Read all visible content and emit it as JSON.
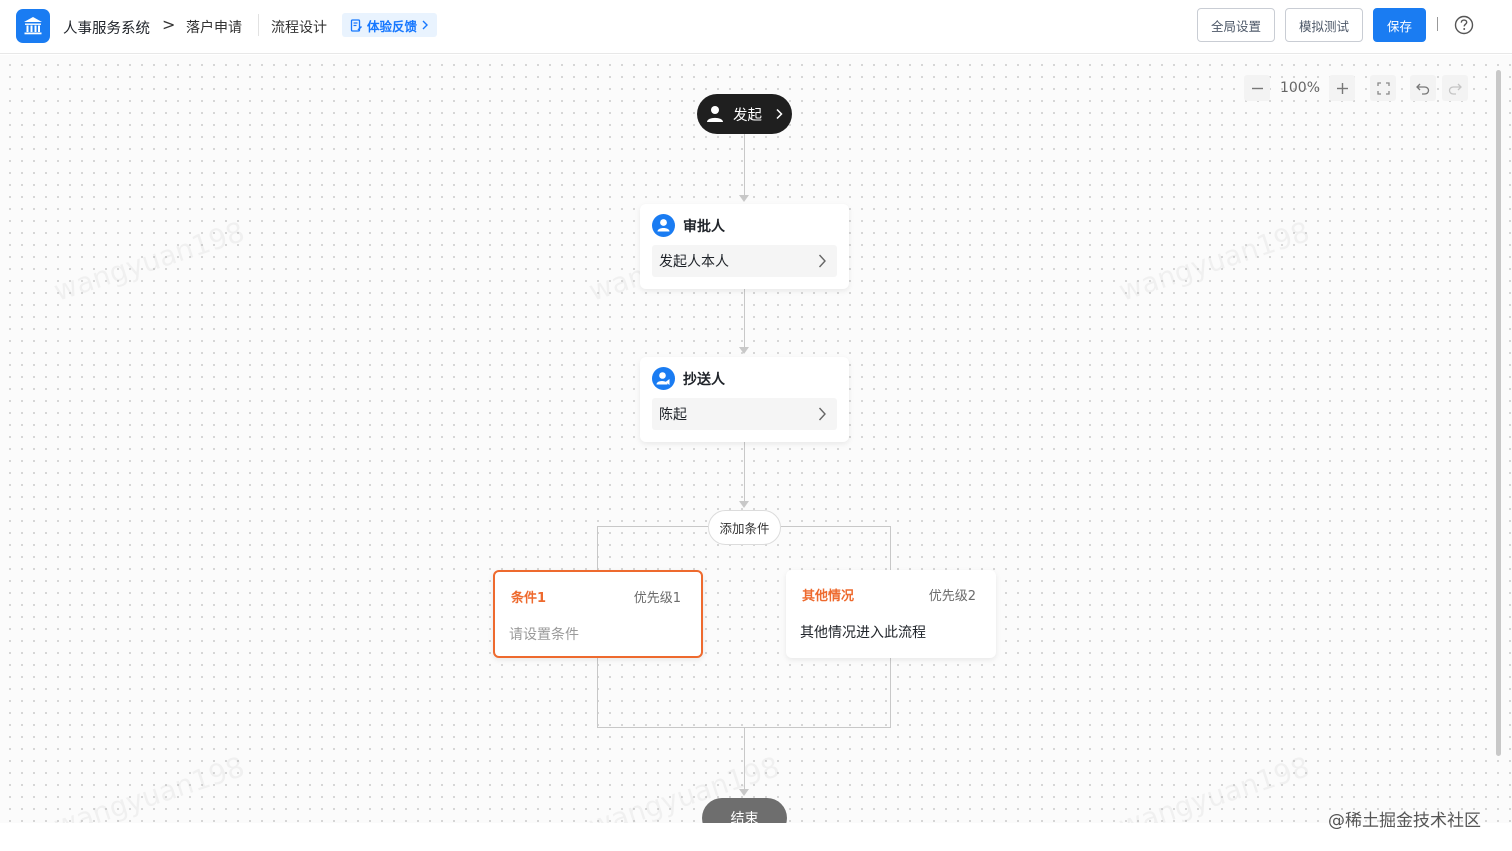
{
  "header": {
    "app_name": "人事服务系统",
    "crumb_separator": ">",
    "page_name": "落户申请",
    "section_name": "流程设计",
    "feedback_label": "体验反馈",
    "buttons": {
      "global_settings": "全局设置",
      "simulate_test": "模拟测试",
      "save": "保存"
    },
    "help_icon": "question-circle-icon"
  },
  "toolbar": {
    "zoom_level": "100%"
  },
  "flow": {
    "start_label": "发起",
    "approver": {
      "title": "审批人",
      "value": "发起人本人"
    },
    "cc": {
      "title": "抄送人",
      "value": "陈起"
    },
    "add_condition_label": "添加条件",
    "conditions": [
      {
        "title": "条件1",
        "priority": "优先级1",
        "desc": "请设置条件"
      },
      {
        "title": "其他情况",
        "priority": "优先级2",
        "desc": "其他情况进入此流程"
      }
    ],
    "end_label": "结束"
  },
  "watermark_text": "wangyuan198",
  "credit_text": "@稀土掘金技术社区",
  "colors": {
    "primary": "#1a7cf2",
    "accent_orange": "#ee6a2e",
    "start_node": "#1f1f1f",
    "end_node": "#6e6e6e"
  }
}
